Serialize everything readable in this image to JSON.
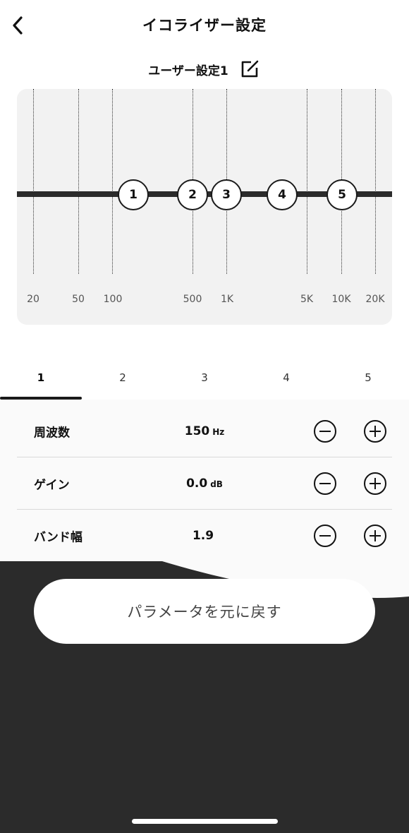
{
  "header": {
    "title": "イコライザー設定",
    "back_icon": "chevron-left-icon"
  },
  "preset": {
    "name": "ユーザー設定1",
    "edit_icon": "edit-icon"
  },
  "eq": {
    "frequency_labels": [
      "20",
      "50",
      "100",
      "500",
      "1K",
      "5K",
      "10K",
      "20K"
    ],
    "bands": [
      "1",
      "2",
      "3",
      "4",
      "5"
    ]
  },
  "tabs": [
    "1",
    "2",
    "3",
    "4",
    "5"
  ],
  "active_tab": "1",
  "params": [
    {
      "label": "周波数",
      "value": "150",
      "unit": "Hz"
    },
    {
      "label": "ゲイン",
      "value": "0.0",
      "unit": "dB"
    },
    {
      "label": "バンド幅",
      "value": "1.9",
      "unit": ""
    }
  ],
  "reset_button": {
    "label": "パラメータを元に戻す"
  },
  "colors": {
    "dark": "#2b2b2b",
    "graph_bg": "#f2f2f2",
    "divider": "#d8d8d8"
  }
}
